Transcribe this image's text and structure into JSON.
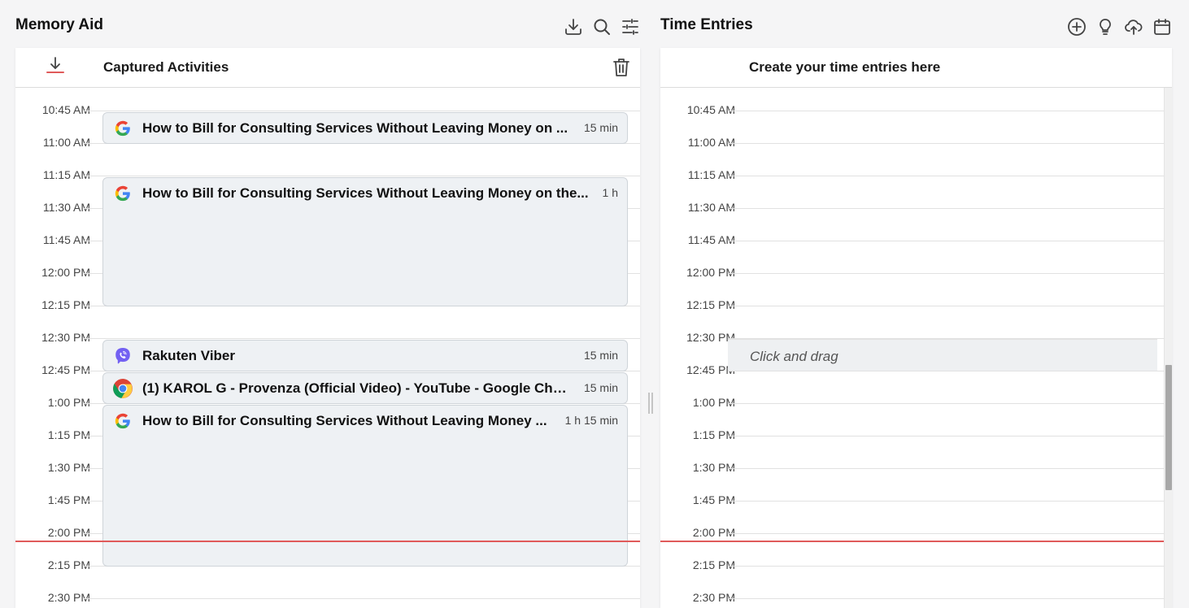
{
  "memory_aid": {
    "title": "Memory Aid",
    "icons": [
      "download-icon",
      "search-icon",
      "filter-sliders-icon"
    ],
    "panel_title": "Captured Activities"
  },
  "time_entries": {
    "title": "Time Entries",
    "icons": [
      "add-circle-icon",
      "lightbulb-icon",
      "cloud-upload-icon",
      "calendar-icon"
    ],
    "panel_title": "Create your time entries here",
    "placeholder": "Click and drag"
  },
  "time_labels": [
    "10:45 AM",
    "11:00 AM",
    "11:15 AM",
    "11:30 AM",
    "11:45 AM",
    "12:00 PM",
    "12:15 PM",
    "12:30 PM",
    "12:45 PM",
    "1:00 PM",
    "1:15 PM",
    "1:30 PM",
    "1:45 PM",
    "2:00 PM",
    "2:15 PM",
    "2:30 PM"
  ],
  "activities": [
    {
      "title": "How to Bill for Consulting Services Without Leaving Money on the Table",
      "display": "How to Bill for Consulting Services Without Leaving Money on ...",
      "duration": "15 min",
      "icon": "google-icon"
    },
    {
      "title": "How to Bill for Consulting Services Without Leaving Money on the Table",
      "display": "How to Bill for Consulting Services Without Leaving Money on the...",
      "duration": "1 h",
      "icon": "google-icon"
    },
    {
      "title": "Rakuten Viber",
      "display": "Rakuten Viber",
      "duration": "15 min",
      "icon": "viber-icon"
    },
    {
      "title": "(1) KAROL G - Provenza (Official Video) - YouTube - Google Chrome",
      "display": "(1) KAROL G - Provenza (Official Video) - YouTube - Google Chr...",
      "duration": "15 min",
      "icon": "chrome-icon"
    },
    {
      "title": "How to Bill for Consulting Services Without Leaving Money on the Table",
      "display": "How to Bill for Consulting Services Without Leaving Money ...",
      "duration": "1 h 15 min",
      "icon": "google-icon"
    }
  ],
  "colors": {
    "accent_red": "#e05a5a",
    "activity_bg": "#eef1f4",
    "viber_purple": "#7360f2"
  }
}
